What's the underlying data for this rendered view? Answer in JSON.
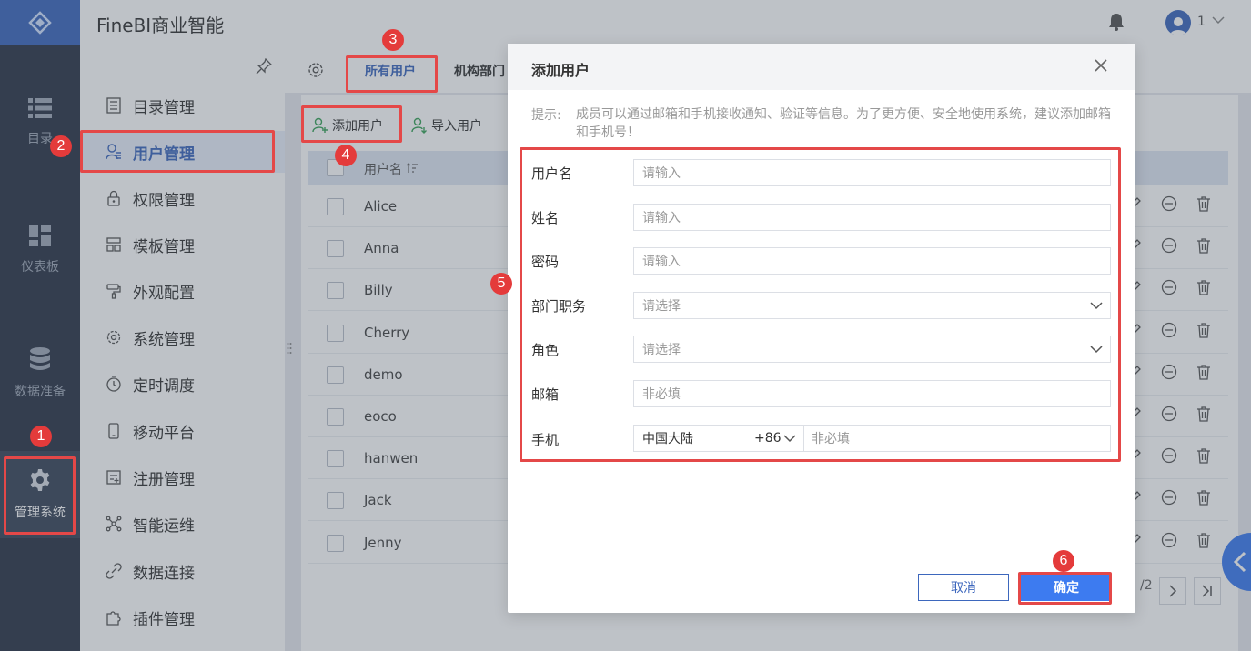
{
  "app": {
    "title": "FineBI商业智能",
    "user_count": "1"
  },
  "rail": {
    "items": [
      {
        "label": "目录",
        "icon": "list-icon"
      },
      {
        "label": "仪表板",
        "icon": "dashboard-icon"
      },
      {
        "label": "数据准备",
        "icon": "database-icon"
      },
      {
        "label": "管理系统",
        "icon": "gear-icon"
      }
    ]
  },
  "sidebar": {
    "items": [
      {
        "label": "目录管理"
      },
      {
        "label": "用户管理"
      },
      {
        "label": "权限管理"
      },
      {
        "label": "模板管理"
      },
      {
        "label": "外观配置"
      },
      {
        "label": "系统管理"
      },
      {
        "label": "定时调度"
      },
      {
        "label": "移动平台"
      },
      {
        "label": "注册管理"
      },
      {
        "label": "智能运维"
      },
      {
        "label": "数据连接"
      },
      {
        "label": "插件管理"
      }
    ]
  },
  "tabs": {
    "all_users": "所有用户",
    "org": "机构部门"
  },
  "toolbar": {
    "add_user": "添加用户",
    "import_user": "导入用户"
  },
  "table": {
    "header": "用户名",
    "rows": [
      "Alice",
      "Anna",
      "Billy",
      "Cherry",
      "demo",
      "eoco",
      "hanwen",
      "Jack",
      "Jenny"
    ]
  },
  "pager": {
    "text": "/2"
  },
  "dialog": {
    "title": "添加用户",
    "hint_label": "提示:",
    "hint_text": "成员可以通过邮箱和手机接收通知、验证等信息。为了更方便、安全地使用系统，建议添加邮箱和手机号！",
    "fields": {
      "username": {
        "label": "用户名",
        "placeholder": "请输入"
      },
      "realname": {
        "label": "姓名",
        "placeholder": "请输入"
      },
      "password": {
        "label": "密码",
        "placeholder": "请输入"
      },
      "department": {
        "label": "部门职务",
        "placeholder": "请选择"
      },
      "role": {
        "label": "角色",
        "placeholder": "请选择"
      },
      "email": {
        "label": "邮箱",
        "placeholder": "非必填"
      },
      "phone": {
        "label": "手机",
        "country": "中国大陆",
        "code": "+86",
        "placeholder": "非必填"
      }
    },
    "cancel": "取消",
    "confirm": "确定"
  },
  "annotations": [
    "1",
    "2",
    "3",
    "4",
    "5",
    "6"
  ],
  "colors": {
    "accent": "#3d67bd",
    "primary_button": "#3d7bf0",
    "annotation": "#e43b3b",
    "rail": "#2b3547"
  }
}
